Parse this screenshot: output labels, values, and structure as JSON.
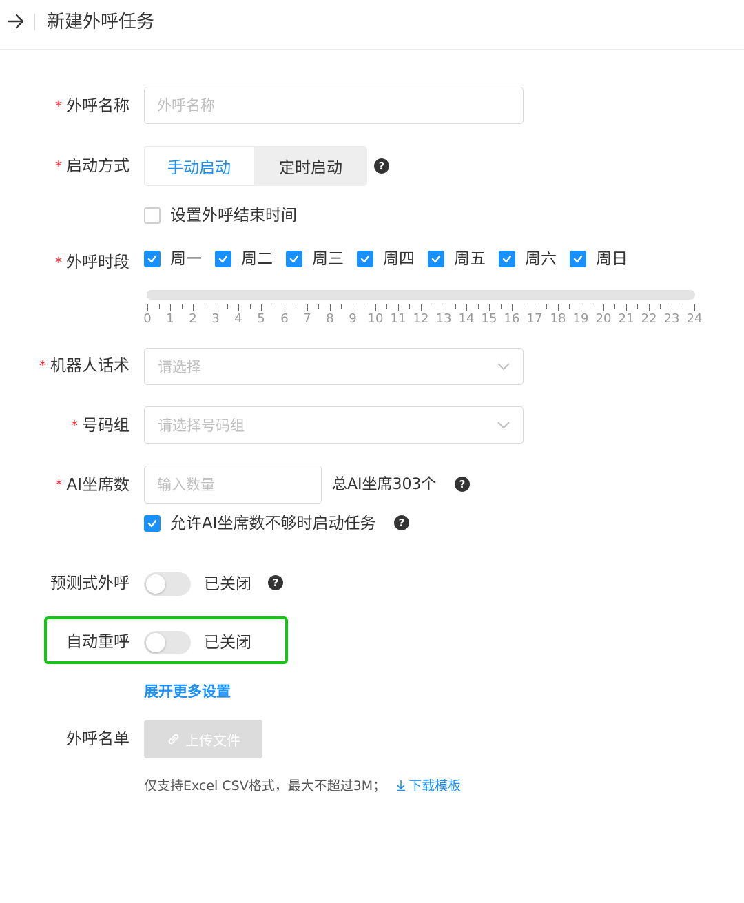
{
  "header": {
    "title": "新建外呼任务"
  },
  "form": {
    "name": {
      "label": "外呼名称",
      "placeholder": "外呼名称"
    },
    "start_mode": {
      "label": "启动方式",
      "options": [
        "手动启动",
        "定时启动"
      ],
      "selected": "手动启动"
    },
    "end_time": {
      "label": "设置外呼结束时间",
      "checked": false
    },
    "period": {
      "label": "外呼时段",
      "days": [
        {
          "label": "周一",
          "checked": true
        },
        {
          "label": "周二",
          "checked": true
        },
        {
          "label": "周三",
          "checked": true
        },
        {
          "label": "周四",
          "checked": true
        },
        {
          "label": "周五",
          "checked": true
        },
        {
          "label": "周六",
          "checked": true
        },
        {
          "label": "周日",
          "checked": true
        }
      ],
      "hours": [
        "0",
        "1",
        "2",
        "3",
        "4",
        "5",
        "6",
        "7",
        "8",
        "9",
        "10",
        "11",
        "12",
        "13",
        "14",
        "15",
        "16",
        "17",
        "18",
        "19",
        "20",
        "21",
        "22",
        "23",
        "24"
      ]
    },
    "script": {
      "label": "机器人话术",
      "placeholder": "请选择"
    },
    "number_group": {
      "label": "号码组",
      "placeholder": "请选择号码组"
    },
    "ai_seats": {
      "label": "AI坐席数",
      "placeholder": "输入数量",
      "total": "总AI坐席303个",
      "allow_label": "允许AI坐席数不够时启动任务",
      "allow_checked": true
    },
    "predictive": {
      "label": "预测式外呼",
      "status": "已关闭",
      "on": false
    },
    "auto_redial": {
      "label": "自动重呼",
      "status": "已关闭",
      "on": false
    },
    "expand_link": "展开更多设置",
    "list": {
      "label": "外呼名单",
      "upload_label": "上传文件",
      "hint": "仅支持Excel CSV格式，最大不超过3M；",
      "download_link": "下载模板"
    }
  },
  "colors": {
    "primary": "#1890ff",
    "required": "#f5222d",
    "highlight": "#16c516"
  }
}
